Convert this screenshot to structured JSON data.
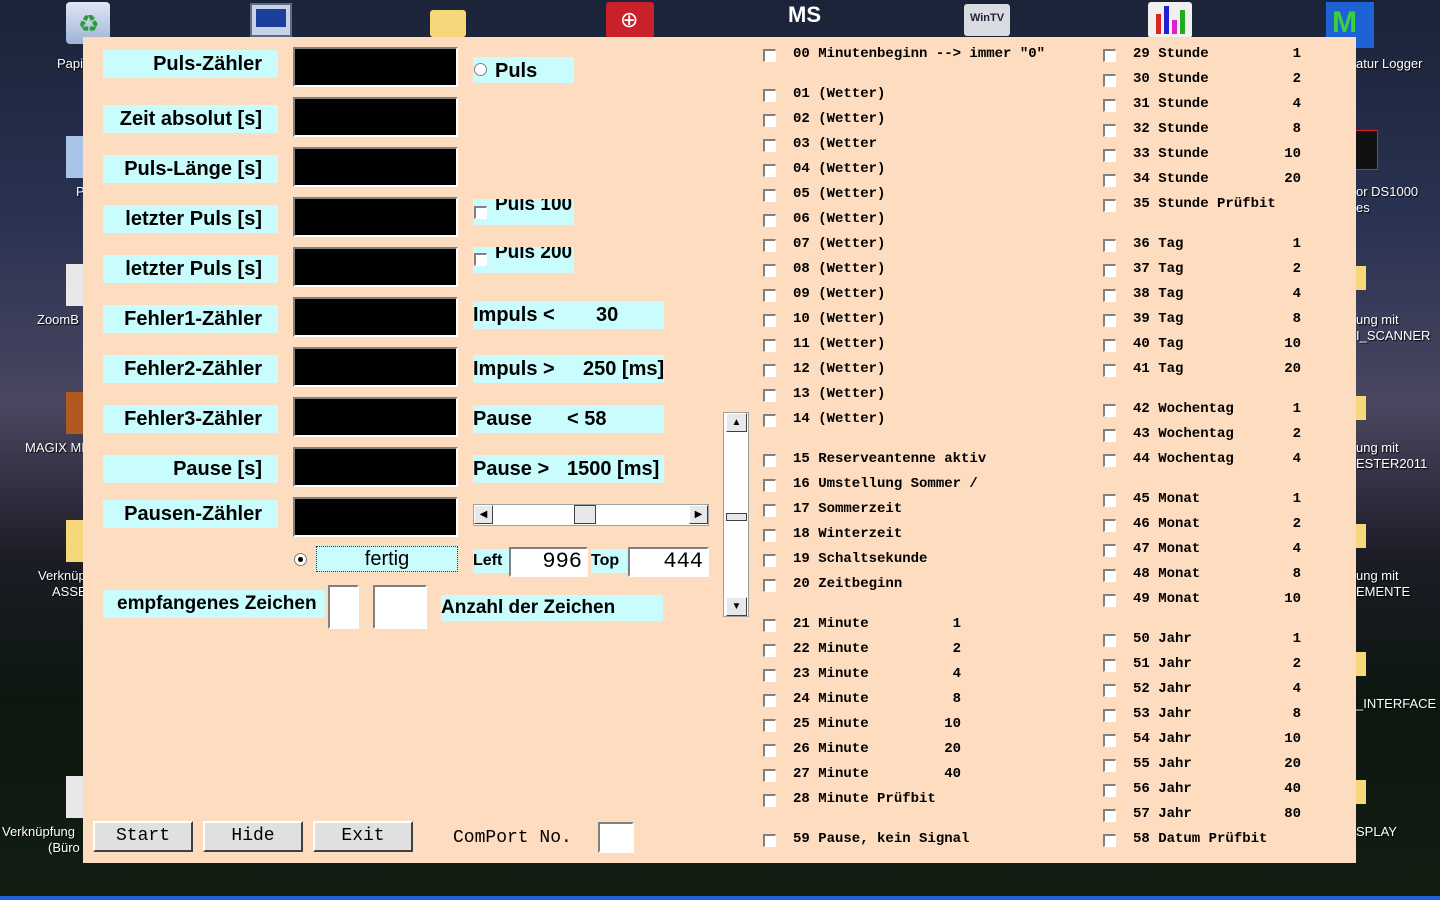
{
  "desktop": {
    "icons": [
      {
        "label": "Papi"
      },
      {
        "label": "ZoomB"
      },
      {
        "label": "MAGIX MP"
      },
      {
        "label": "Verknüp"
      },
      {
        "label": "ASSE"
      },
      {
        "label": "Verknüpfung"
      },
      {
        "label": "(Büro"
      },
      {
        "label": "atur Logger"
      },
      {
        "label": "or DS1000"
      },
      {
        "label": "es"
      },
      {
        "label": "ung mit"
      },
      {
        "label": "I_SCANNER"
      },
      {
        "label": "ung mit"
      },
      {
        "label": "ESTER2011"
      },
      {
        "label": "ung mit"
      },
      {
        "label": "EMENTE"
      },
      {
        "label": "_INTERFACE"
      },
      {
        "label": "SPLAY"
      },
      {
        "label": "P"
      }
    ],
    "top_icons": [
      "MS",
      "WinTV"
    ]
  },
  "app": {
    "labels": {
      "puls_zaehler": "Puls-Zähler",
      "zeit_absolut": "Zeit absolut [s]",
      "puls_laenge": "Puls-Länge [s]",
      "letzter_puls_1": "letzter Puls [s]",
      "letzter_puls_2": "letzter Puls [s]",
      "fehler1": "Fehler1-Zähler",
      "fehler2": "Fehler2-Zähler",
      "fehler3": "Fehler3-Zähler",
      "pause": "Pause [s]",
      "pausen_zaehler": "Pausen-Zähler",
      "empfangenes_zeichen": "empfangenes Zeichen",
      "anzahl_zeichen": "Anzahl der Zeichen"
    },
    "puls_radio": "Puls",
    "puls100": "Puls 100",
    "puls200": "Puls 200",
    "impuls_lt": {
      "label": "Impuls <",
      "value": "30"
    },
    "impuls_gt": {
      "label": "Impuls >",
      "value": "250 [ms]"
    },
    "pause_lt": {
      "label": "Pause",
      "value": "< 58"
    },
    "pause_gt": {
      "label": "Pause >",
      "value": "1500 [ms]"
    },
    "fertig": "fertig",
    "left_label": "Left",
    "left_value": "996",
    "top_label": "Top",
    "top_value": "444",
    "buttons": {
      "start": "Start",
      "hide": "Hide",
      "exit": "Exit"
    },
    "comport_label": "ComPort No.",
    "bits_left": [
      "00 Minutenbeginn --> immer \"0\"",
      "01 (Wetter)",
      "02 (Wetter)",
      "03 (Wetter",
      "04 (Wetter)",
      "05 (Wetter)",
      "06 (Wetter)",
      "07 (Wetter)",
      "08 (Wetter)",
      "09 (Wetter)",
      "10 (Wetter)",
      "11 (Wetter)",
      "12 (Wetter)",
      "13 (Wetter)",
      "14 (Wetter)",
      "15 Reserveantenne aktiv",
      "16 Umstellung Sommer /",
      "17 Sommerzeit",
      "18 Winterzeit",
      "19 Schaltsekunde",
      "20 Zeitbeginn",
      "21 Minute          1",
      "22 Minute          2",
      "23 Minute          4",
      "24 Minute          8",
      "25 Minute         10",
      "26 Minute         20",
      "27 Minute         40",
      "28 Minute Prüfbit",
      "59 Pause, kein Signal"
    ],
    "bits_right": [
      "29 Stunde          1",
      "30 Stunde          2",
      "31 Stunde          4",
      "32 Stunde          8",
      "33 Stunde         10",
      "34 Stunde         20",
      "35 Stunde Prüfbit",
      "36 Tag             1",
      "37 Tag             2",
      "38 Tag             4",
      "39 Tag             8",
      "40 Tag            10",
      "41 Tag            20",
      "42 Wochentag       1",
      "43 Wochentag       2",
      "44 Wochentag       4",
      "45 Monat           1",
      "46 Monat           2",
      "47 Monat           4",
      "48 Monat           8",
      "49 Monat          10",
      "50 Jahr            1",
      "51 Jahr            2",
      "52 Jahr            4",
      "53 Jahr            8",
      "54 Jahr           10",
      "55 Jahr           20",
      "56 Jahr           40",
      "57 Jahr           80",
      "58 Datum Prüfbit"
    ]
  }
}
